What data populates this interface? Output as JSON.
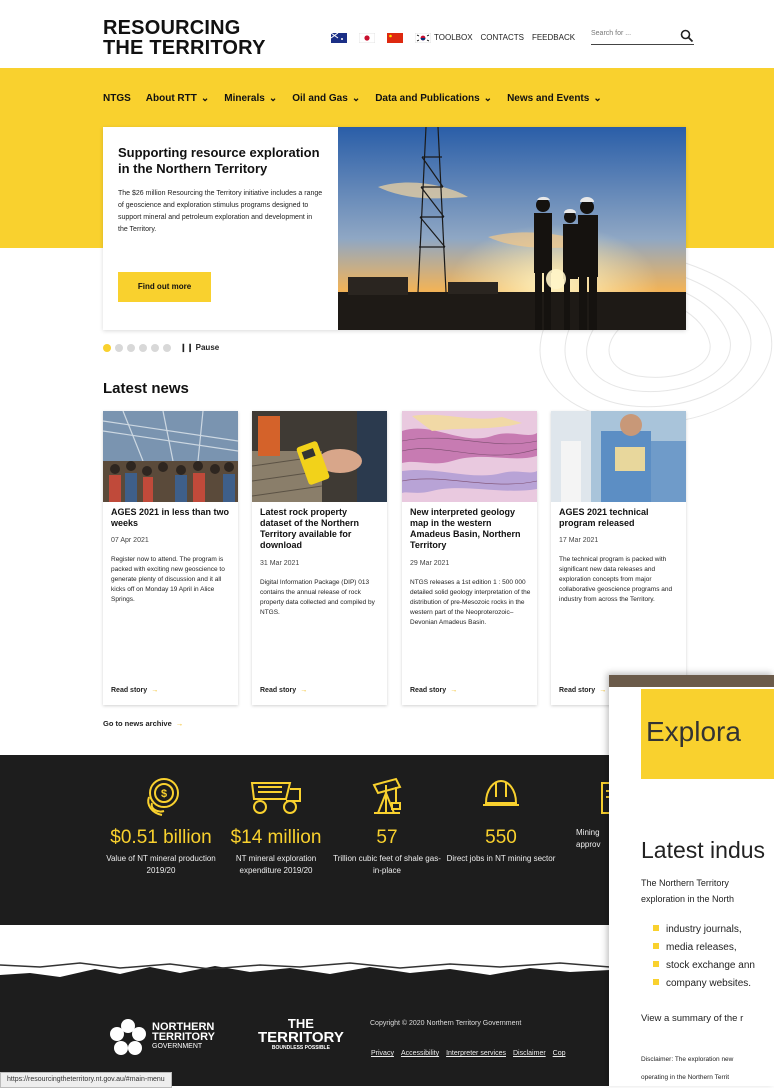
{
  "header": {
    "logo_line1": "RESOURCING",
    "logo_line2": "THE TERRITORY",
    "flags": [
      "australia-flag-icon",
      "japan-flag-icon",
      "china-flag-icon",
      "korea-flag-icon"
    ],
    "links": [
      "TOOLBOX",
      "CONTACTS",
      "FEEDBACK"
    ],
    "search_placeholder": "Search for ..."
  },
  "nav": {
    "items": [
      {
        "label": "NTGS",
        "dropdown": false
      },
      {
        "label": "About RTT",
        "dropdown": true
      },
      {
        "label": "Minerals",
        "dropdown": true
      },
      {
        "label": "Oil and Gas",
        "dropdown": true
      },
      {
        "label": "Data and Publications",
        "dropdown": true
      },
      {
        "label": "News and Events",
        "dropdown": true
      }
    ]
  },
  "hero": {
    "title": "Supporting resource exploration in the Northern Territory",
    "text": "The $26 million Resourcing the Territory initiative includes a range of geoscience and exploration stimulus programs designed to support mineral and petroleum exploration and development in the Territory.",
    "button": "Find out more",
    "pause_label": "Pause"
  },
  "news": {
    "heading": "Latest news",
    "cards": [
      {
        "title": "AGES 2021 in less than two weeks",
        "date": "07 Apr 2021",
        "text": "Register now to attend. The program is packed with exciting new geoscience to generate plenty of discussion and it all kicks off on Monday 19 April in Alice Springs.",
        "read": "Read story"
      },
      {
        "title": "Latest rock property dataset of the Northern Territory available for download",
        "date": "31 Mar 2021",
        "text": "Digital Information Package (DIP) 013 contains the annual release of rock property data collected and compiled by NTGS.",
        "read": "Read story"
      },
      {
        "title": "New interpreted geology map in the western Amadeus Basin, Northern Territory",
        "date": "29 Mar 2021",
        "text": "NTGS releases a 1st edition 1 : 500 000 detailed solid geology interpretation of the distribution of pre-Mesozoic rocks in the western part of the Neoproterozoic–Devonian Amadeus Basin.",
        "read": "Read story"
      },
      {
        "title": "AGES 2021 technical program released",
        "date": "17 Mar 2021",
        "text": "The technical program is packed with significant new data releases and exploration concepts from major collaborative geoscience programs and industry from across the Territory.",
        "read": "Read story"
      }
    ],
    "archive": "Go to news archive"
  },
  "stats": [
    {
      "value": "$0.51 billion",
      "label": "Value of NT mineral production 2019/20",
      "icon": "coins-icon"
    },
    {
      "value": "$14 million",
      "label": "NT mineral exploration expenditure 2019/20",
      "icon": "haul-truck-icon"
    },
    {
      "value": "57",
      "label": "Trillion cubic feet of shale gas-in-place",
      "icon": "oil-rig-icon"
    },
    {
      "value": "550",
      "label": "Direct jobs in NT mining sector",
      "icon": "hard-hat-icon"
    },
    {
      "value": "",
      "label": "Mining approv",
      "icon": "document-icon"
    }
  ],
  "footer": {
    "nt_gov_line1": "NORTHERN",
    "nt_gov_line2": "TERRITORY",
    "nt_gov_line3": "GOVERNMENT",
    "territory_line1": "THE",
    "territory_line2": "TERRITORY",
    "territory_line3": "BOUNDLESS POSSIBLE",
    "copyright": "Copyright © 2020 Northern Territory Government",
    "links": [
      "Privacy",
      "Accessibility",
      "Interpreter services",
      "Disclaimer",
      "Cop"
    ]
  },
  "status_url": "https://resourcingtheterritory.nt.gov.au/#main-menu",
  "overlay": {
    "banner": "Explora",
    "heading": "Latest indus",
    "intro_line1": "The Northern Territory",
    "intro_line2": "exploration in the North",
    "list": [
      "industry journals,",
      "media releases,",
      "stock exchange ann",
      "company websites."
    ],
    "view": "View a summary of the r",
    "disclaimer_line1": "Disclaimer: The exploration new",
    "disclaimer_line2": "operating in the Northern Territ"
  },
  "colors": {
    "accent": "#f9d12e",
    "dark": "#1d1d1d"
  }
}
